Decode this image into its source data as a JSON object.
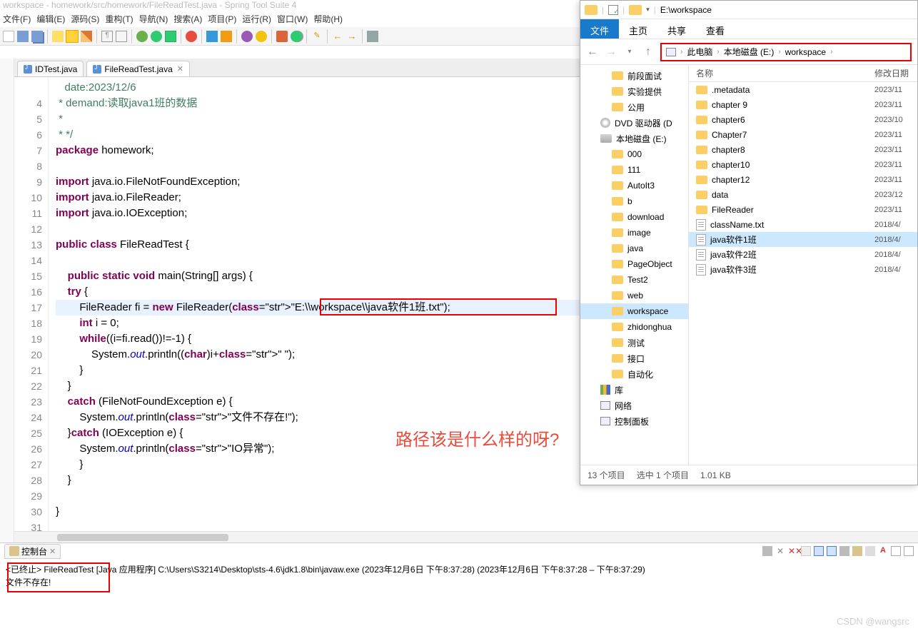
{
  "ide": {
    "title": "workspace - homework/src/homework/FileReadTest.java - Spring Tool Suite 4",
    "menus": [
      "文件(F)",
      "编辑(E)",
      "源码(S)",
      "重构(T)",
      "导航(N)",
      "搜索(A)",
      "项目(P)",
      "运行(R)",
      "窗口(W)",
      "帮助(H)"
    ],
    "tabs": [
      {
        "label": "IDTest.java",
        "active": false
      },
      {
        "label": "FileReadTest.java",
        "active": true
      }
    ]
  },
  "code": {
    "lines": [
      {
        "n": "",
        "raw": "   date:2023/12/6"
      },
      {
        "n": "4",
        "raw": " * demand:读取java1班的数据"
      },
      {
        "n": "5",
        "raw": " *"
      },
      {
        "n": "6",
        "raw": " * */"
      },
      {
        "n": "7",
        "raw": "package homework;"
      },
      {
        "n": "8",
        "raw": ""
      },
      {
        "n": "9",
        "raw": "import java.io.FileNotFoundException;"
      },
      {
        "n": "10",
        "raw": "import java.io.FileReader;"
      },
      {
        "n": "11",
        "raw": "import java.io.IOException;"
      },
      {
        "n": "12",
        "raw": ""
      },
      {
        "n": "13",
        "raw": "public class FileReadTest {"
      },
      {
        "n": "14",
        "raw": ""
      },
      {
        "n": "15",
        "raw": "    public static void main(String[] args) {"
      },
      {
        "n": "16",
        "raw": "    try {"
      },
      {
        "n": "17",
        "raw": "        FileReader fi = new FileReader(\"E:\\\\workspace\\\\java软件1班.txt\");"
      },
      {
        "n": "18",
        "raw": "        int i = 0;"
      },
      {
        "n": "19",
        "raw": "        while((i=fi.read())!=-1) {"
      },
      {
        "n": "20",
        "raw": "            System.out.println((char)i+\" \");"
      },
      {
        "n": "21",
        "raw": "        }"
      },
      {
        "n": "22",
        "raw": "    }"
      },
      {
        "n": "23",
        "raw": "    catch (FileNotFoundException e) {"
      },
      {
        "n": "24",
        "raw": "        System.out.println(\"文件不存在!\");"
      },
      {
        "n": "25",
        "raw": "    }catch (IOException e) {"
      },
      {
        "n": "26",
        "raw": "        System.out.println(\"IO异常\");"
      },
      {
        "n": "27",
        "raw": "        }"
      },
      {
        "n": "28",
        "raw": "    }"
      },
      {
        "n": "29",
        "raw": ""
      },
      {
        "n": "30",
        "raw": "}"
      },
      {
        "n": "31",
        "raw": ""
      }
    ],
    "highlight_line_idx": 14,
    "path_string": "\"E:\\\\workspace\\\\java软件1班.txt\""
  },
  "annotation": {
    "text": "路径该是什么样的呀?"
  },
  "console": {
    "tab": "控制台",
    "header": "<已终止> FileReadTest [Java 应用程序] C:\\Users\\S3214\\Desktop\\sts-4.6\\jdk1.8\\bin\\javaw.exe  (2023年12月6日 下午8:37:28)   (2023年12月6日 下午8:37:28 – 下午8:37:29)",
    "output": "文件不存在!"
  },
  "explorer": {
    "title_path": "E:\\workspace",
    "ribbon": {
      "file": "文件",
      "home": "主页",
      "share": "共享",
      "view": "查看"
    },
    "breadcrumb": [
      "此电脑",
      "本地磁盘 (E:)",
      "workspace"
    ],
    "tree": [
      {
        "label": "前段面试",
        "ic": "foldic",
        "lvl": 1
      },
      {
        "label": "实验提供",
        "ic": "foldic",
        "lvl": 1
      },
      {
        "label": "公用",
        "ic": "foldic",
        "lvl": 1
      },
      {
        "label": "DVD 驱动器 (D",
        "ic": "dvdic",
        "lvl": 0
      },
      {
        "label": "本地磁盘 (E:)",
        "ic": "diskic",
        "lvl": 0
      },
      {
        "label": "000",
        "ic": "foldic",
        "lvl": 1
      },
      {
        "label": "111",
        "ic": "foldic",
        "lvl": 1
      },
      {
        "label": "AutoIt3",
        "ic": "foldic",
        "lvl": 1
      },
      {
        "label": "b",
        "ic": "foldic",
        "lvl": 1
      },
      {
        "label": "download",
        "ic": "foldic",
        "lvl": 1
      },
      {
        "label": "image",
        "ic": "foldic",
        "lvl": 1
      },
      {
        "label": "java",
        "ic": "foldic",
        "lvl": 1
      },
      {
        "label": "PageObject",
        "ic": "foldic",
        "lvl": 1
      },
      {
        "label": "Test2",
        "ic": "foldic",
        "lvl": 1
      },
      {
        "label": "web",
        "ic": "foldic",
        "lvl": 1
      },
      {
        "label": "workspace",
        "ic": "foldic",
        "lvl": 1,
        "sel": true
      },
      {
        "label": "zhidonghua",
        "ic": "foldic",
        "lvl": 1
      },
      {
        "label": "测试",
        "ic": "foldic",
        "lvl": 1
      },
      {
        "label": "接口",
        "ic": "foldic",
        "lvl": 1
      },
      {
        "label": "自动化",
        "ic": "foldic",
        "lvl": 1
      },
      {
        "label": "库",
        "ic": "libic",
        "lvl": 0
      },
      {
        "label": "网络",
        "ic": "pcic",
        "lvl": 0
      },
      {
        "label": "控制面板",
        "ic": "pcic",
        "lvl": 0
      }
    ],
    "columns": {
      "name": "名称",
      "date": "修改日期"
    },
    "files": [
      {
        "name": ".metadata",
        "date": "2023/11",
        "ic": "foldic"
      },
      {
        "name": "chapter 9",
        "date": "2023/11",
        "ic": "foldic"
      },
      {
        "name": "chapter6",
        "date": "2023/10",
        "ic": "foldic"
      },
      {
        "name": "Chapter7",
        "date": "2023/11",
        "ic": "foldic"
      },
      {
        "name": "chapter8",
        "date": "2023/11",
        "ic": "foldic"
      },
      {
        "name": "chapter10",
        "date": "2023/11",
        "ic": "foldic"
      },
      {
        "name": "chapter12",
        "date": "2023/11",
        "ic": "foldic"
      },
      {
        "name": "data",
        "date": "2023/12",
        "ic": "foldic"
      },
      {
        "name": "FileReader",
        "date": "2023/11",
        "ic": "foldic"
      },
      {
        "name": "className.txt",
        "date": "2018/4/",
        "ic": "txtic"
      },
      {
        "name": "java软件1班",
        "date": "2018/4/",
        "ic": "txtic",
        "sel": true
      },
      {
        "name": "java软件2班",
        "date": "2018/4/",
        "ic": "txtic"
      },
      {
        "name": "java软件3班",
        "date": "2018/4/",
        "ic": "txtic"
      }
    ],
    "status": {
      "count": "13 个项目",
      "selected": "选中 1 个项目",
      "size": "1.01 KB"
    }
  },
  "watermark": "CSDN @wangsrc"
}
